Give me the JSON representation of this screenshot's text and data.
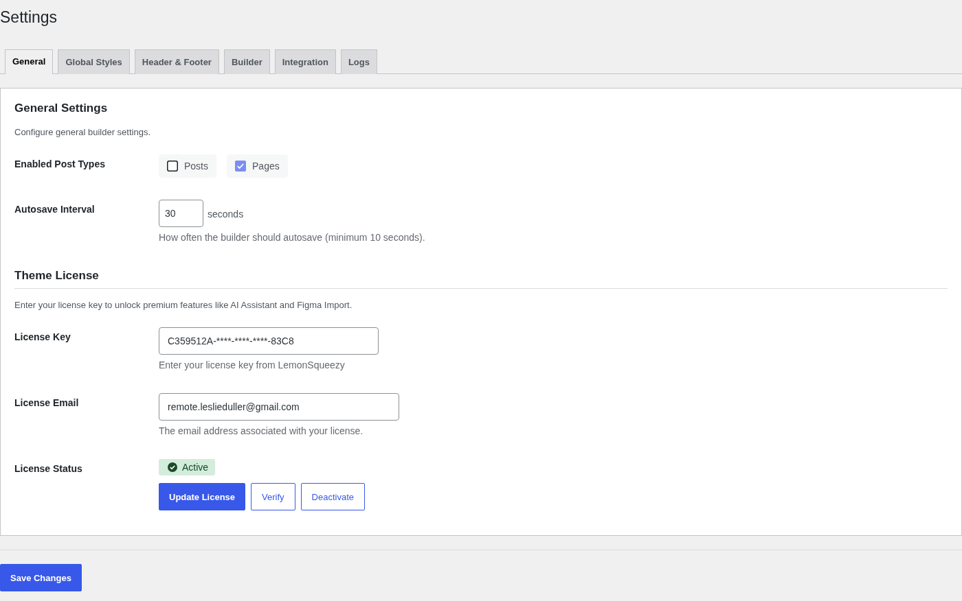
{
  "page": {
    "title": "Settings"
  },
  "tabs": [
    {
      "label": "General",
      "selected": true
    },
    {
      "label": "Global Styles",
      "selected": false
    },
    {
      "label": "Header & Footer",
      "selected": false
    },
    {
      "label": "Builder",
      "selected": false
    },
    {
      "label": "Integration",
      "selected": false
    },
    {
      "label": "Logs",
      "selected": false
    }
  ],
  "sections": [
    {
      "heading": "General Settings",
      "divider": false,
      "description": "Configure general builder settings.",
      "rows": [
        {
          "kind": "checkboxes",
          "label": "Enabled Post Types",
          "options": [
            {
              "label": "Posts",
              "checked": false
            },
            {
              "label": "Pages",
              "checked": true
            }
          ]
        },
        {
          "kind": "number",
          "label": "Autosave Interval",
          "value": "30",
          "unit": "seconds",
          "help": "How often the builder should autosave (minimum 10 seconds)."
        }
      ]
    },
    {
      "heading": "Theme License",
      "divider": true,
      "description": "Enter your license key to unlock premium features like AI Assistant and Figma Import.",
      "rows": [
        {
          "kind": "text",
          "label": "License Key",
          "value": "C359512A-****-****-****-83C8",
          "help": "Enter your license key from LemonSqueezy"
        },
        {
          "kind": "email",
          "label": "License Email",
          "value": "remote.leslieduller@gmail.com",
          "help": "The email address associated with your license."
        },
        {
          "kind": "status",
          "label": "License Status",
          "status": {
            "label": "Active",
            "active": true
          },
          "buttons": [
            {
              "label": "Update License",
              "kind": "primary"
            },
            {
              "label": "Verify",
              "kind": "secondary"
            },
            {
              "label": "Deactivate",
              "kind": "secondary"
            }
          ]
        }
      ]
    }
  ],
  "footer": {
    "save_button": "Save Changes"
  }
}
